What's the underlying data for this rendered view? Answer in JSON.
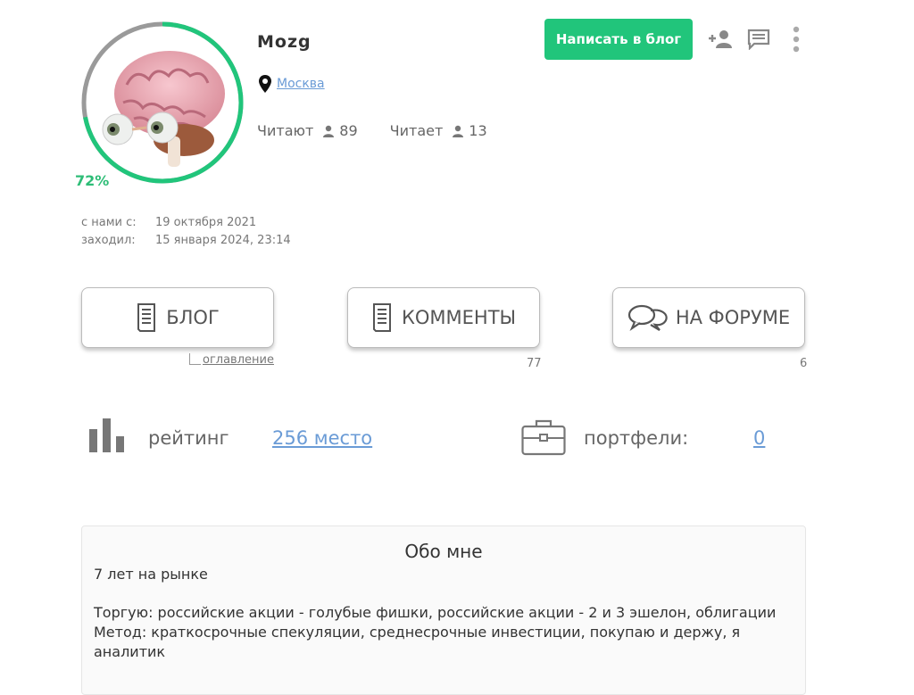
{
  "profile": {
    "username": "Mozg",
    "city": "Москва",
    "progress_percent": 72,
    "progress_label": "72%",
    "readers_label": "Читают",
    "readers_count": "89",
    "reading_label": "Читает",
    "reading_count": "13"
  },
  "header": {
    "write_blog_label": "Написать в блог",
    "icons": [
      "add-friend-icon",
      "message-icon",
      "more-vert-icon"
    ]
  },
  "dates": {
    "joined_label": "с нами с:",
    "joined_value": "19 октября 2021",
    "visited_label": "заходил:",
    "visited_value": "15 января 2024, 23:14"
  },
  "sections": {
    "blog_label": "БЛОГ",
    "blog_toc_label": "оглавление",
    "comments_label": "КОММЕНТЫ",
    "comments_count": "77",
    "forum_label": "НА ФОРУМЕ",
    "forum_count": "6"
  },
  "stats": {
    "rating_label": "рейтинг",
    "rating_value": "256 место",
    "portfolios_label": "портфели:",
    "portfolios_value": "0"
  },
  "about": {
    "title": "Обо мне",
    "line1": "7 лет на рынке",
    "line2": "Торгую: российские акции - голубые фишки, российские акции - 2 и 3 эшелон, облигации",
    "line3": "Метод: краткосрочные спекуляции, среднесрочные инвестиции, покупаю и держу, я",
    "line4": "аналитик"
  },
  "colors": {
    "accent_green": "#21c57b",
    "link_blue": "#6a9bd6",
    "ring_track": "#9a9a9a"
  }
}
